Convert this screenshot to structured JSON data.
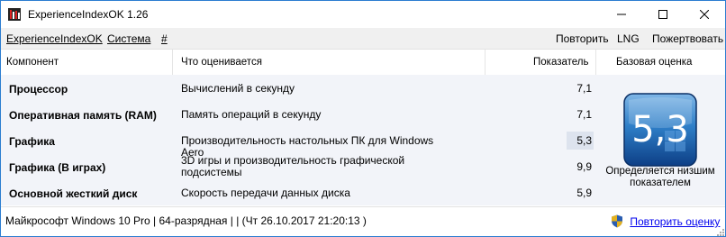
{
  "window": {
    "title": "ExperienceIndexOK 1.26",
    "icons": {
      "app": "bars-chart-icon",
      "minimize": "minimize-icon",
      "maximize": "maximize-icon",
      "close": "close-icon"
    }
  },
  "menu": {
    "app": "ExperienceIndexOK",
    "system": "Система",
    "hash": "#",
    "repeat": "Повторить",
    "lng": "LNG",
    "donate": "Пожертвовать"
  },
  "columns": {
    "component": "Компонент",
    "what": "Что оценивается",
    "score": "Показатель",
    "base": "Базовая оценка"
  },
  "rows": [
    {
      "component": "Процессор",
      "what": "Вычислений в секунду",
      "score": "7,1",
      "highlight": false
    },
    {
      "component": "Оперативная память (RAM)",
      "what": "Память операций в секунду",
      "score": "7,1",
      "highlight": false
    },
    {
      "component": "Графика",
      "what": "Производительность настольных ПК для Windows Aero",
      "score": "5,3",
      "highlight": true
    },
    {
      "component": "Графика (В играх)",
      "what": "3D игры и производительность графической подсистемы",
      "score": "9,9",
      "highlight": false
    },
    {
      "component": "Основной жесткий диск",
      "what": "Скорость передачи данных диска",
      "score": "5,9",
      "highlight": false
    }
  ],
  "base_score": {
    "value": "5,3",
    "caption": "Определяется низшим показателем",
    "badge_colors": {
      "light": "#7fb6e6",
      "mid": "#2f7fc8",
      "dark": "#0d3f86"
    }
  },
  "status": {
    "text": "Майкрософт Windows 10 Pro | 64-разрядная | | (Чт 26.10.2017 21:20:13 )",
    "rerun_label": "Повторить оценку",
    "shield_icon": "uac-shield-icon",
    "link_color": "#0000ee"
  }
}
